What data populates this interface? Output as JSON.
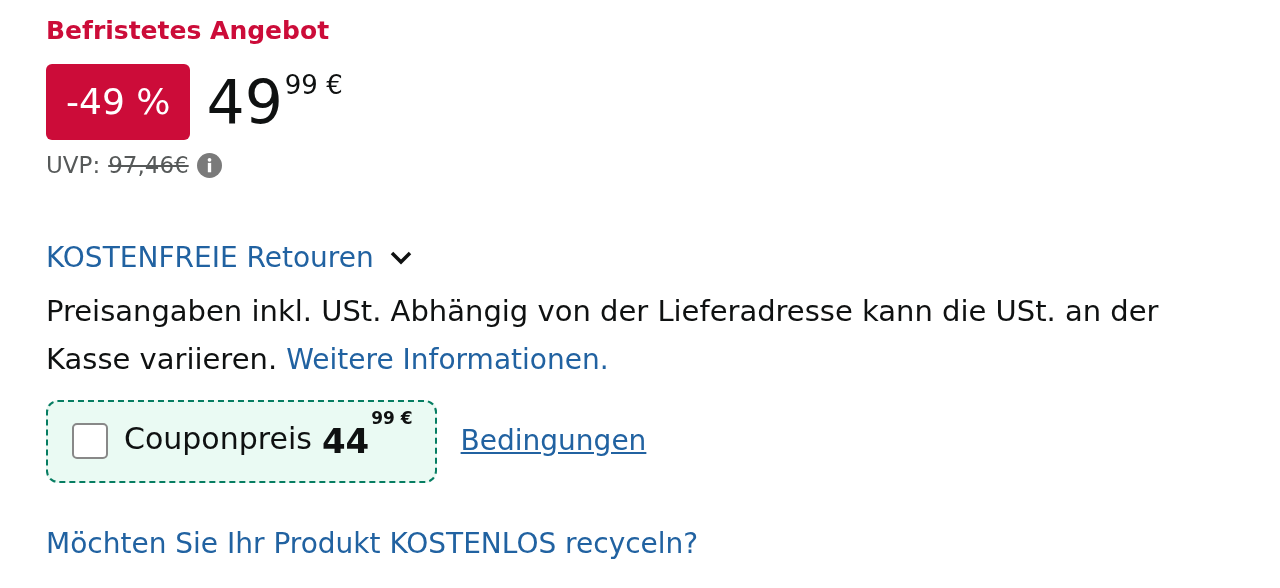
{
  "deal_label": "Befristetes Angebot",
  "discount_badge": "-49 %",
  "price": {
    "whole": "49",
    "fraction": "99",
    "currency": "€"
  },
  "list_price": {
    "label": "UVP:",
    "value": "97,46€",
    "struck": true
  },
  "returns_link": {
    "text": "KOSTENFREIE Retouren",
    "expanded": false
  },
  "tax_note": {
    "text": "Preisangaben inkl. USt. Abhängig von der Lieferadresse kann die USt. an der Kasse variieren.",
    "link": "Weitere Informationen."
  },
  "coupon": {
    "checked": false,
    "label": "Couponpreis",
    "price": {
      "whole": "44",
      "fraction": "99",
      "currency": "€"
    },
    "terms_link": "Bedingungen"
  },
  "recycle_link": "Möchten Sie Ihr Produkt KOSTENLOS recyceln?"
}
